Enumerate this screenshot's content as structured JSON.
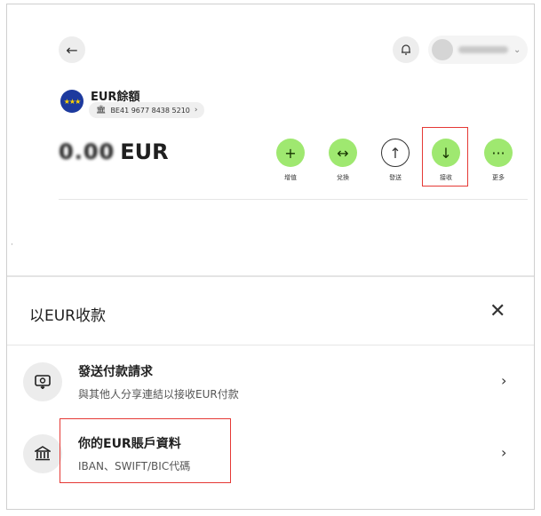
{
  "header": {
    "back_icon": "arrow-left-icon",
    "notification_icon": "bell-icon",
    "profile": {
      "chevron": "⌄"
    }
  },
  "account": {
    "flag": "eu-flag-icon",
    "title": "EUR餘額",
    "iban": "BE41 9677 8438 5210",
    "amount_masked": "0.00",
    "currency": "EUR"
  },
  "actions": [
    {
      "symbol": "+",
      "label": "增值"
    },
    {
      "symbol": "↔",
      "label": "兌換"
    },
    {
      "symbol": "↑",
      "label": "發送"
    },
    {
      "symbol": "↓",
      "label": "接收"
    },
    {
      "symbol": "···",
      "label": "更多"
    }
  ],
  "sheet": {
    "title": "以EUR收款",
    "close_symbol": "✕",
    "options": [
      {
        "icon": "payment-request-icon",
        "title": "發送付款請求",
        "subtitle": "與其他人分享連結以接收EUR付款"
      },
      {
        "icon": "bank-icon",
        "title": "你的EUR賬戶資料",
        "subtitle": "IBAN、SWIFT/BIC代碼"
      }
    ]
  },
  "colors": {
    "accent_green": "#9fe870",
    "highlight_red": "#e53935",
    "flag_blue": "#1d3a9e"
  }
}
